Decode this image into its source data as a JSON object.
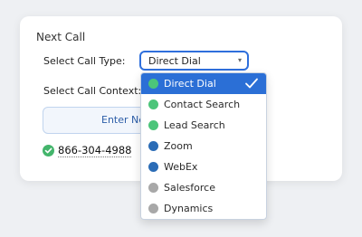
{
  "form": {
    "title": "Next Call",
    "call_type_label": "Select Call Type:",
    "call_context_label": "Select Call Context:",
    "selected_call_type": "Direct Dial",
    "enter_button_label": "Enter Ne",
    "phone_number": "866-304-4988"
  },
  "dropdown": {
    "options": [
      {
        "label": "Direct Dial",
        "dot_color": "#4cc57a",
        "selected": true
      },
      {
        "label": "Contact Search",
        "dot_color": "#4cc57a",
        "selected": false
      },
      {
        "label": "Lead Search",
        "dot_color": "#4cc57a",
        "selected": false
      },
      {
        "label": "Zoom",
        "dot_color": "#2b6cb6",
        "selected": false
      },
      {
        "label": "WebEx",
        "dot_color": "#2b6cb6",
        "selected": false
      },
      {
        "label": "Salesforce",
        "dot_color": "#a8a8a8",
        "selected": false
      },
      {
        "label": "Dynamics",
        "dot_color": "#a8a8a8",
        "selected": false
      }
    ]
  },
  "icons": {
    "select_caret": "chevron-down-icon",
    "selected_option_check": "check-icon",
    "phone_status": "check-circle-icon"
  }
}
